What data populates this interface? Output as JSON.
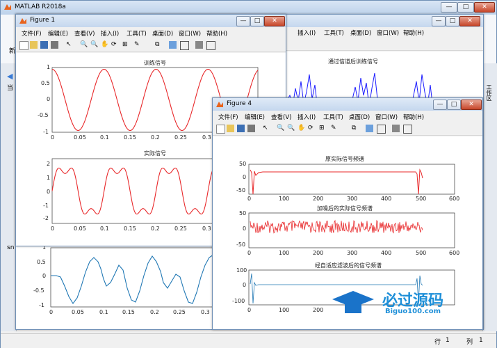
{
  "matlab": {
    "title": "MATLAB R2018a",
    "left_labels": [
      "新",
      "当",
      "sn"
    ],
    "right_label": "工作区",
    "status": {
      "row_label": "行",
      "row_value": "1",
      "col_label": "列",
      "col_value": "1"
    }
  },
  "menus": [
    "文件(F)",
    "编辑(E)",
    "查看(V)",
    "插入(I)",
    "工具(T)",
    "桌面(D)",
    "窗口(W)",
    "帮助(H)"
  ],
  "figure1": {
    "title": "Figure 1",
    "plot1": {
      "title": "训练信号",
      "yticks": [
        "1",
        "0.5",
        "0",
        "-0.5",
        "-1"
      ],
      "xticks": [
        "0",
        "0.05",
        "0.1",
        "0.15",
        "0.2",
        "0.25",
        "0.3"
      ]
    },
    "plot2": {
      "title": "实际信号",
      "yticks": [
        "2",
        "1",
        "0",
        "-1",
        "-2"
      ],
      "xticks": [
        "0",
        "0.05",
        "0.1",
        "0.15",
        "0.2",
        "0.25",
        "0.3"
      ]
    }
  },
  "figure_behind": {
    "plot_title": "通过信道后训练信号",
    "bottom_yticks": [
      "1",
      "0.5",
      "0",
      "-0.5",
      "-1"
    ],
    "bottom_xticks": [
      "0",
      "0.05",
      "0.1",
      "0.15",
      "0.2",
      "0.25",
      "0.3"
    ]
  },
  "figure4": {
    "title": "Figure 4",
    "plot1": {
      "title": "原实际信号频谱",
      "yticks": [
        "50",
        "0",
        "-50"
      ],
      "xticks": [
        "0",
        "100",
        "200",
        "300",
        "400",
        "500",
        "600"
      ]
    },
    "plot2": {
      "title": "加噪后的实际信号频谱",
      "yticks": [
        "50",
        "0",
        "-50"
      ],
      "xticks": [
        "0",
        "100",
        "200",
        "300",
        "400",
        "500",
        "600"
      ]
    },
    "plot3": {
      "title": "经自适应滤波后的信号频谱",
      "yticks": [
        "100",
        "0",
        "-100"
      ],
      "xticks": [
        "0",
        "100",
        "200"
      ]
    }
  },
  "watermark": {
    "text": "必过源码",
    "url": "Biguo100.com"
  },
  "colors": {
    "red": "#e8282a",
    "blue": "#1a1aff",
    "matlab_blue": "#1f77b4"
  },
  "icons": [
    "new-file-icon",
    "open-folder-icon",
    "save-icon",
    "print-icon",
    "pointer-icon",
    "zoom-in-icon",
    "zoom-out-icon",
    "pan-icon",
    "rotate-icon",
    "data-cursor-icon",
    "brush-icon",
    "link-icon",
    "colorbar-icon",
    "legend-icon",
    "hide-plot-icon",
    "dock-icon"
  ]
}
